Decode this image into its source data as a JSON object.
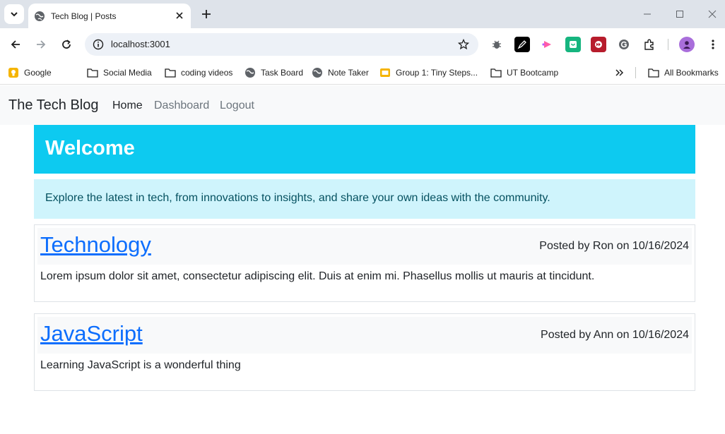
{
  "browser": {
    "tab_title": "Tech Blog | Posts",
    "address": "localhost:3001",
    "bookmarks": [
      {
        "label": "Google",
        "icon": "google-icon"
      },
      {
        "label": "Social Media",
        "icon": "folder-icon"
      },
      {
        "label": "coding videos",
        "icon": "folder-icon"
      },
      {
        "label": "Task Board",
        "icon": "globe-icon"
      },
      {
        "label": "Note Taker",
        "icon": "globe-icon"
      },
      {
        "label": "Group 1: Tiny Steps...",
        "icon": "slides-icon"
      },
      {
        "label": "UT Bootcamp",
        "icon": "folder-icon"
      }
    ],
    "all_bookmarks": "All Bookmarks"
  },
  "site": {
    "brand": "The Tech Blog",
    "nav": [
      {
        "label": "Home",
        "active": true
      },
      {
        "label": "Dashboard",
        "active": false
      },
      {
        "label": "Logout",
        "active": false
      }
    ],
    "welcome_title": "Welcome",
    "intro": "Explore the latest in tech, from innovations to insights, and share your own ideas with the community."
  },
  "posts": [
    {
      "title": "Technology",
      "meta": "Posted by Ron on 10/16/2024",
      "body": "Lorem ipsum dolor sit amet, consectetur adipiscing elit. Duis at enim mi. Phasellus mollis ut mauris at tincidunt."
    },
    {
      "title": "JavaScript",
      "meta": "Posted by Ann on 10/16/2024",
      "body": "Learning JavaScript is a wonderful thing"
    }
  ],
  "colors": {
    "accent": "#0dcaf0",
    "link": "#0d6efd",
    "intro_bg": "#cff4fc",
    "intro_text": "#055160"
  }
}
